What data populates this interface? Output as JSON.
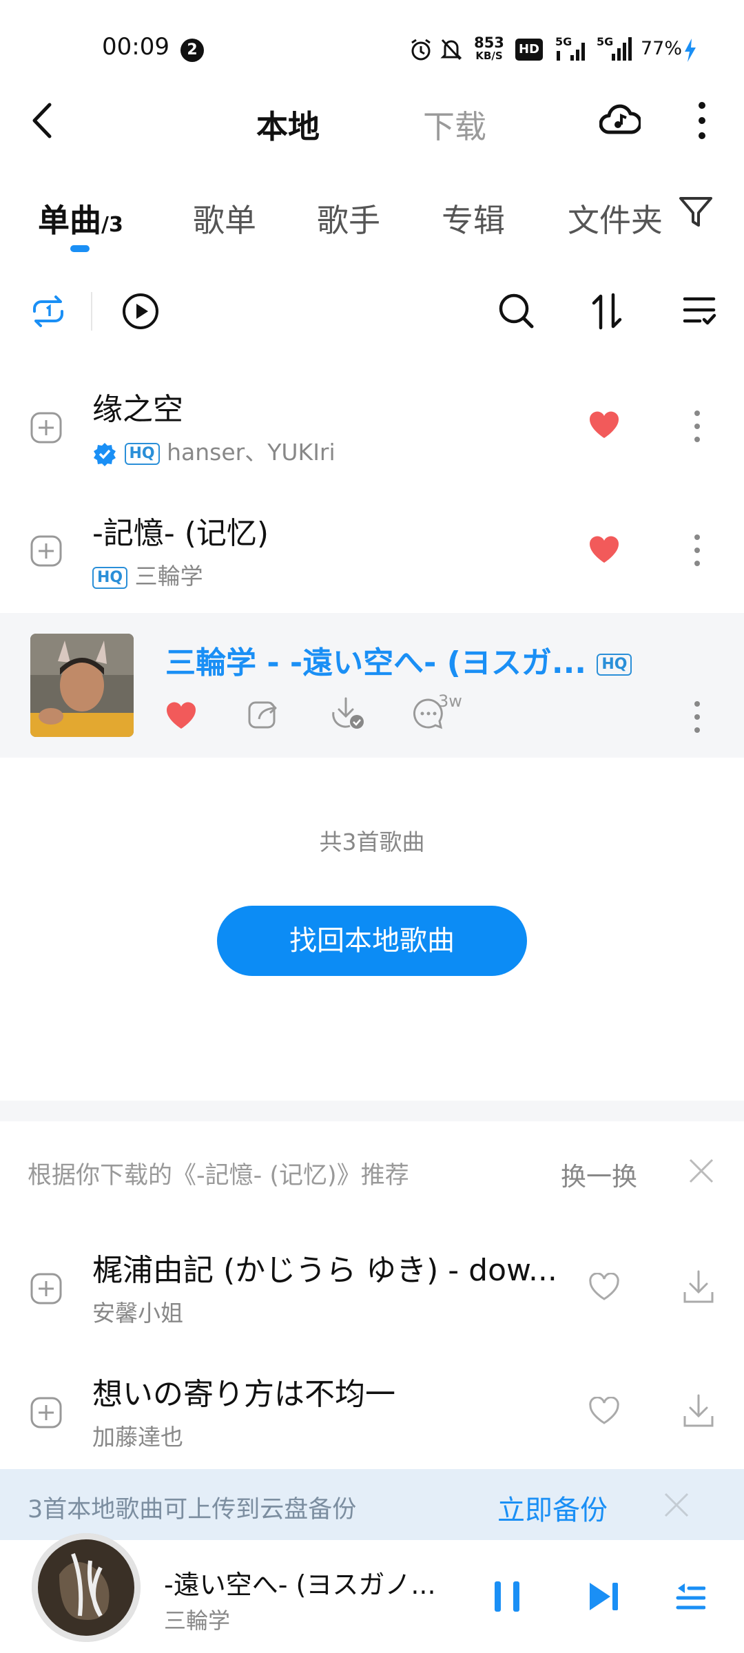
{
  "status_bar": {
    "time": "00:09",
    "notification_count": "2",
    "net_speed_value": "853",
    "net_speed_unit": "KB/S",
    "hd_label": "HD",
    "sim1_label": "5G",
    "sim2_label": "5G",
    "battery": "77%"
  },
  "header": {
    "title": "本地",
    "download_tab": "下载"
  },
  "tabs": [
    {
      "label": "单曲",
      "count": "/3"
    },
    {
      "label": "歌单"
    },
    {
      "label": "歌手"
    },
    {
      "label": "专辑"
    },
    {
      "label": "文件夹"
    }
  ],
  "songs": [
    {
      "title": "缘之空",
      "badge": "HQ",
      "artist": "hanser、YUKIri"
    },
    {
      "title": "-記憶- (记忆)",
      "badge": "HQ",
      "artist": "三輪学"
    }
  ],
  "now_playing": {
    "title": "三輪学 - -遠い空へ- (ヨスガ...",
    "badge": "HQ",
    "comment_count": "3w"
  },
  "list_footer": {
    "count_text": "共3首歌曲",
    "recover_button": "找回本地歌曲"
  },
  "recommend": {
    "heading": "根据你下载的《-記憶- (记忆)》推荐",
    "swap": "换一换",
    "items": [
      {
        "title": "梶浦由記 (かじうら ゆき) - dow...",
        "artist": "安馨小姐"
      },
      {
        "title": "想いの寄り方は不均一",
        "artist": "加藤達也"
      }
    ]
  },
  "backup_banner": {
    "text": "3首本地歌曲可上传到云盘备份",
    "button": "立即备份"
  },
  "mini_player": {
    "title": "-遠い空へ- (ヨスガノ...",
    "artist": "三輪学"
  },
  "colors": {
    "accent": "#1a8ff5",
    "heart": "#f25a5a",
    "banner_bg": "#e4eef8"
  }
}
